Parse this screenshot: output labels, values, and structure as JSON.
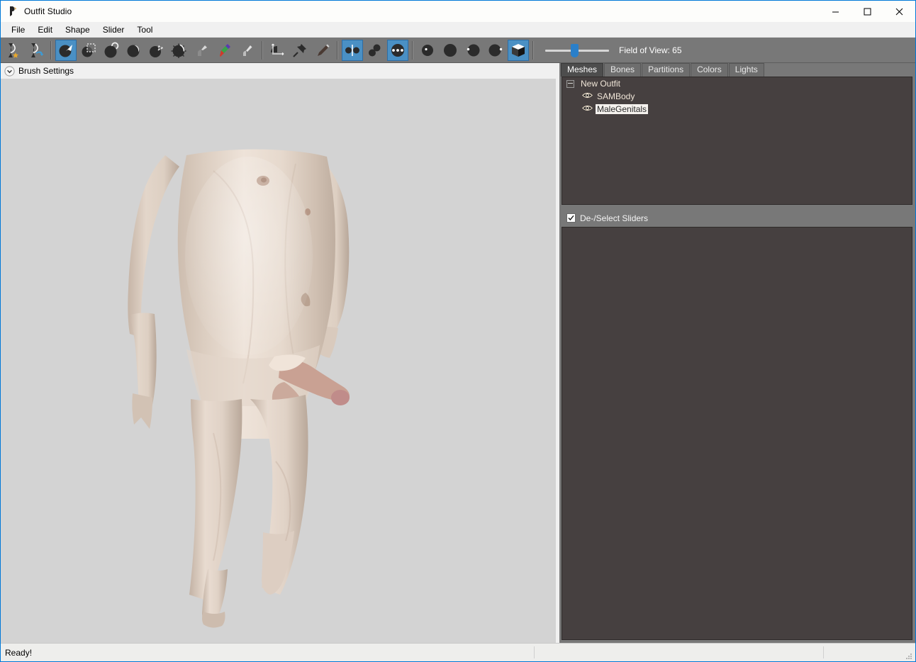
{
  "window": {
    "title": "Outfit Studio",
    "app_icon": "outfit-studio-icon",
    "minimize_label": "Minimize",
    "maximize_label": "Maximize",
    "close_label": "Close"
  },
  "menubar": {
    "items": [
      {
        "label": "File"
      },
      {
        "label": "Edit"
      },
      {
        "label": "Shape"
      },
      {
        "label": "Slider"
      },
      {
        "label": "Tool"
      }
    ]
  },
  "toolbar": {
    "groups": [
      {
        "buttons": [
          {
            "icon": "save-project-icon",
            "name": "save-project-button",
            "active": false
          },
          {
            "icon": "load-reference-icon",
            "name": "load-reference-button",
            "active": false
          }
        ]
      },
      {
        "buttons": [
          {
            "icon": "select-brush-icon",
            "name": "tool-select-button",
            "active": true
          },
          {
            "icon": "marquee-select-icon",
            "name": "tool-marquee-button",
            "active": false
          },
          {
            "icon": "inflate-brush-icon",
            "name": "tool-inflate-button",
            "active": false
          },
          {
            "icon": "deflate-brush-icon",
            "name": "tool-deflate-button",
            "active": false
          },
          {
            "icon": "move-brush-icon",
            "name": "tool-move-button",
            "active": false
          },
          {
            "icon": "smooth-brush-icon",
            "name": "tool-smooth-button",
            "active": false
          },
          {
            "icon": "weight-paint-icon",
            "name": "tool-weight-paint-button",
            "active": false
          },
          {
            "icon": "color-paint-icon",
            "name": "tool-color-paint-button",
            "active": false
          },
          {
            "icon": "alpha-paint-icon",
            "name": "tool-alpha-paint-button",
            "active": false
          }
        ]
      },
      {
        "buttons": [
          {
            "icon": "transform-icon",
            "name": "tool-transform-button",
            "active": false
          },
          {
            "icon": "pivot-pin-icon",
            "name": "tool-pivot-button",
            "active": false
          },
          {
            "icon": "vertex-edit-icon",
            "name": "tool-vertex-edit-button",
            "active": false
          }
        ]
      },
      {
        "buttons": [
          {
            "icon": "symmetry-mirror-icon",
            "name": "toggle-symmetry-button",
            "active": true
          },
          {
            "icon": "connected-only-icon",
            "name": "toggle-connected-only-button",
            "active": false
          },
          {
            "icon": "show-vertices-icon",
            "name": "toggle-show-vertices-button",
            "active": true
          }
        ]
      },
      {
        "buttons": [
          {
            "icon": "x-mirror-icon",
            "name": "toggle-x-mirror-button",
            "active": false
          },
          {
            "icon": "lighting-icon",
            "name": "toggle-lighting-button",
            "active": false
          },
          {
            "icon": "texture-icon",
            "name": "toggle-texture-button",
            "active": false
          },
          {
            "icon": "wireframe-icon",
            "name": "toggle-wireframe-button",
            "active": false
          },
          {
            "icon": "cube-view-icon",
            "name": "toggle-solid-view-button",
            "active": true
          }
        ]
      }
    ],
    "fov": {
      "label": "Field of View: 65",
      "value": 65,
      "min": 10,
      "max": 120,
      "name": "field-of-view-slider"
    }
  },
  "left_panel": {
    "brush_settings": {
      "label": "Brush Settings",
      "expanded": false,
      "chevron_icon": "chevron-down-circle-icon"
    },
    "viewport": {
      "name": "3d-viewport",
      "background_color": "#d3d3d3",
      "model": "male-body-mesh"
    }
  },
  "right_panel": {
    "tabs": [
      {
        "label": "Meshes",
        "active": true
      },
      {
        "label": "Bones",
        "active": false
      },
      {
        "label": "Partitions",
        "active": false
      },
      {
        "label": "Colors",
        "active": false
      },
      {
        "label": "Lights",
        "active": false
      }
    ],
    "mesh_tree": [
      {
        "label": "New Outfit",
        "level": 0,
        "expanded": true,
        "has_collapse_box": true,
        "has_eye": false,
        "selected": false
      },
      {
        "label": "SAMBody",
        "level": 1,
        "has_collapse_box": false,
        "has_eye": true,
        "eye_icon": "eye-visible-icon",
        "selected": false
      },
      {
        "label": "MaleGenitals",
        "level": 1,
        "has_collapse_box": false,
        "has_eye": true,
        "eye_icon": "eye-visible-icon",
        "selected": true
      }
    ],
    "sliders_section": {
      "checkbox_label": "De-/Select Sliders",
      "checked": true,
      "items": []
    }
  },
  "statusbar": {
    "message": "Ready!",
    "field2": "",
    "field3": "",
    "grip_icon": "resize-grip-icon"
  },
  "colors": {
    "accent_blue": "#2a7fc9",
    "toolbar_gray": "#787878",
    "panel_dark": "#464040",
    "viewport_bg": "#d3d3d3",
    "tree_text": "#f0e6d8",
    "selection_bg": "#f5f2ee"
  }
}
